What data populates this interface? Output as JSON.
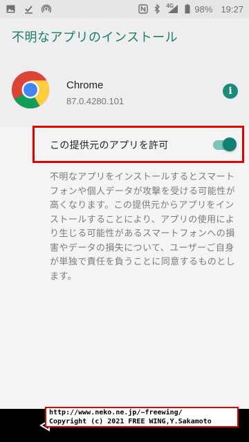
{
  "status_bar": {
    "battery": "98%",
    "time": "19:27",
    "network_badge": "4G",
    "icons_left": [
      "image-icon",
      "check-download-icon",
      "hotspot-icon"
    ],
    "icons_right": [
      "nfc-icon",
      "bluetooth-icon",
      "signal-icon",
      "battery-icon"
    ]
  },
  "page": {
    "title": "不明なアプリのインストール"
  },
  "app": {
    "name": "Chrome",
    "version": "87.0.4280.101",
    "icon": "chrome-logo",
    "info_icon": "info-icon"
  },
  "permission": {
    "label": "この提供元のアプリを許可",
    "enabled": true,
    "accent": "#11806f",
    "highlight_color": "#e00000"
  },
  "description": "不明なアプリをインストールするとスマートフォンや個人データが攻撃を受ける可能性が高くなります。この提供元からアプリをインストールすることにより、アプリの使用により生じる可能性があるスマートフォンへの損害やデータの損失について、ユーザーご自身が単独で責任を負うことに同意するものとします。",
  "watermark": {
    "line1": "http://www.neko.ne.jp/~freewing/",
    "line2": "Copyright (c) 2021 FREE WING,Y.Sakamoto"
  },
  "navbar": {
    "back_icon": "back-triangle-icon"
  }
}
